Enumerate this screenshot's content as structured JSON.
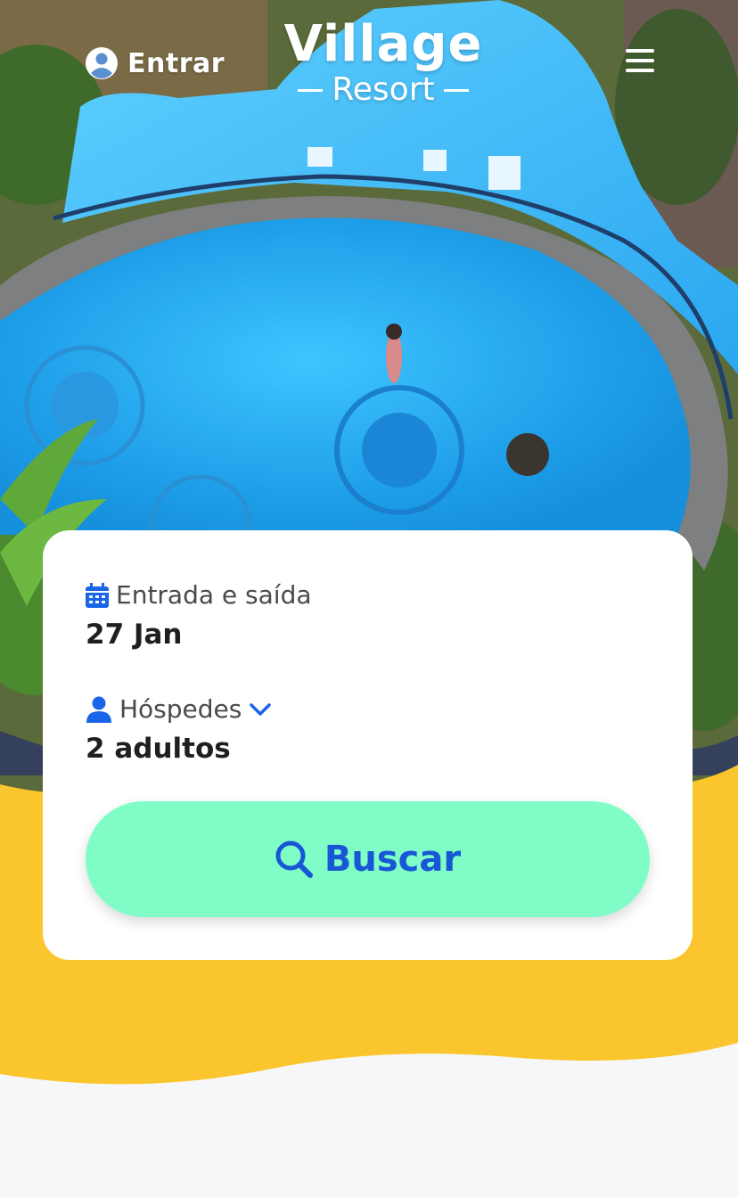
{
  "header": {
    "login_label": "Entrar",
    "logo_main": "Village",
    "logo_sub": "Resort"
  },
  "booking": {
    "dates_label": "Entrada e saída",
    "dates_value": "27 Jan",
    "guests_label": "Hóspedes",
    "guests_value": "2 adultos",
    "search_label": "Buscar"
  },
  "icons": {
    "login": "user-circle-icon",
    "menu": "hamburger-menu-icon",
    "calendar": "calendar-icon",
    "guests": "person-icon",
    "dropdown": "chevron-down-icon",
    "search": "search-icon"
  },
  "colors": {
    "accent_blue": "#1a64e8",
    "button_green": "#80fdc6",
    "band_yellow": "#fbc52d",
    "pool_blue": "#27a8ee"
  }
}
